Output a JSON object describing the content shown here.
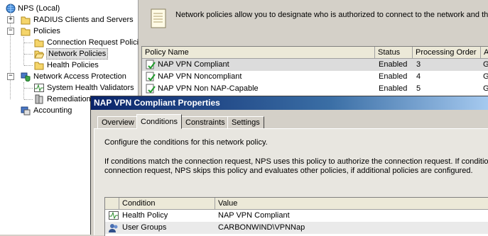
{
  "tree": {
    "root": "NPS (Local)",
    "radius": "RADIUS Clients and Servers",
    "policies": "Policies",
    "conn_req": "Connection Request Polici",
    "network_policies": "Network Policies",
    "health_policies": "Health Policies",
    "nap": "Network Access Protection",
    "shv": "System Health Validators",
    "remediation": "Remediation",
    "accounting": "Accounting"
  },
  "info": {
    "text": "Network policies allow you to designate who is authorized to connect to the network and the c"
  },
  "policies_table": {
    "headers": [
      "Policy Name",
      "Status",
      "Processing Order",
      "A"
    ],
    "rows": [
      {
        "name": "NAP VPN Compliant",
        "status": "Enabled",
        "order": "3",
        "a": "G"
      },
      {
        "name": "NAP VPN Noncompliant",
        "status": "Enabled",
        "order": "4",
        "a": "G"
      },
      {
        "name": "NAP VPN Non NAP-Capable",
        "status": "Enabled",
        "order": "5",
        "a": "G"
      }
    ]
  },
  "dialog": {
    "title": "NAP VPN Compliant Properties",
    "tabs": [
      "Overview",
      "Conditions",
      "Constraints",
      "Settings"
    ],
    "line1": "Configure the conditions for this network policy.",
    "line2": "If conditions match the connection request, NPS uses this policy to authorize the connection request. If conditions d",
    "line3": "connection request, NPS skips this policy and evaluates other policies, if additional policies are configured.",
    "cond_headers": [
      "Condition",
      "Value"
    ],
    "conditions": [
      {
        "condition": "Health Policy",
        "value": "NAP VPN Compliant"
      },
      {
        "condition": "User Groups",
        "value": "CARBONWIND\\VPNNap"
      }
    ]
  }
}
